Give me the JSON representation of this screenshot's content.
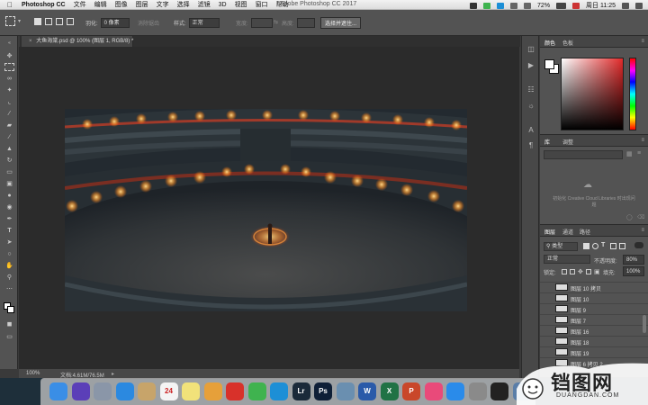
{
  "menubar": {
    "app_name": "Photoshop CC",
    "items": [
      "文件",
      "编辑",
      "图像",
      "图层",
      "文字",
      "选择",
      "滤镜",
      "3D",
      "视图",
      "窗口",
      "帮助"
    ],
    "window_title": "Adobe Photoshop CC 2017",
    "battery": "72%",
    "clock": "周日 11:25"
  },
  "options": {
    "feather_label": "羽化:",
    "feather_value": "0 像素",
    "antialias": "消除锯齿",
    "style_label": "样式:",
    "style_value": "正常",
    "width_label": "宽度:",
    "height_label": "高度:",
    "select_mask": "选择并遮住..."
  },
  "document": {
    "tab_label": "大鱼海棠.psd @ 100% (图层 1, RGB/8) *",
    "zoom": "100%",
    "doc_size": "文档:4.61M/76.5M"
  },
  "color_panel": {
    "tabs": [
      "颜色",
      "色板"
    ],
    "fg_color": "#ffffff",
    "bg_color": "#ffffff",
    "hue_color": "#e22a2a"
  },
  "library_panel": {
    "tabs": [
      "库",
      "调整"
    ],
    "message": "初始化 Creative Cloud Libraries 时出现问题"
  },
  "layers_panel": {
    "tabs": [
      "图层",
      "通道",
      "路径"
    ],
    "kind_filter": "类型",
    "blend_mode": "正常",
    "opacity_label": "不透明度:",
    "opacity_value": "80%",
    "lock_label": "锁定:",
    "fill_label": "填充:",
    "fill_value": "100%",
    "layers": [
      {
        "name": "图层 10 拷贝"
      },
      {
        "name": "图层 10"
      },
      {
        "name": "图层 9"
      },
      {
        "name": "图层 7"
      },
      {
        "name": "图层 16"
      },
      {
        "name": "图层 18"
      },
      {
        "name": "图层 19"
      },
      {
        "name": "图层 6 拷贝 2"
      }
    ]
  },
  "dock": {
    "apps": [
      {
        "name": "finder-icon",
        "label": "",
        "color": "#3a8ee6"
      },
      {
        "name": "siri-icon",
        "label": "",
        "color": "#5b3fb8"
      },
      {
        "name": "launchpad-icon",
        "label": "",
        "color": "#8a96a8"
      },
      {
        "name": "safari-icon",
        "label": "",
        "color": "#2b89e0"
      },
      {
        "name": "notes-icon",
        "label": "",
        "color": "#c7a46a"
      },
      {
        "name": "calendar-icon",
        "label": "24",
        "color": "#f4f4f4"
      },
      {
        "name": "stickies-icon",
        "label": "",
        "color": "#f1e27a"
      },
      {
        "name": "photos-icon",
        "label": "",
        "color": "#e6a03a"
      },
      {
        "name": "netease-icon",
        "label": "",
        "color": "#d8312a"
      },
      {
        "name": "wechat-icon",
        "label": "",
        "color": "#3fb34f"
      },
      {
        "name": "qq-icon",
        "label": "",
        "color": "#1d8fd6"
      },
      {
        "name": "lightroom-icon",
        "label": "Lr",
        "color": "#1a2a3a"
      },
      {
        "name": "photoshop-icon",
        "label": "Ps",
        "color": "#0e1f37"
      },
      {
        "name": "preview-icon",
        "label": "",
        "color": "#6a8fb0"
      },
      {
        "name": "word-icon",
        "label": "W",
        "color": "#2a5aa9"
      },
      {
        "name": "excel-icon",
        "label": "X",
        "color": "#207245"
      },
      {
        "name": "powerpoint-icon",
        "label": "P",
        "color": "#c9472a"
      },
      {
        "name": "music-icon",
        "label": "",
        "color": "#e94a7a"
      },
      {
        "name": "appstore-icon",
        "label": "",
        "color": "#2a8bea"
      },
      {
        "name": "settings-icon",
        "label": "",
        "color": "#8a8a8a"
      },
      {
        "name": "terminal-icon",
        "label": "",
        "color": "#222222"
      },
      {
        "name": "downloads-icon",
        "label": "",
        "color": "#5a7ea8"
      }
    ]
  },
  "watermark": {
    "text": "铛图网",
    "sub": "DUANGDAN.COM"
  }
}
